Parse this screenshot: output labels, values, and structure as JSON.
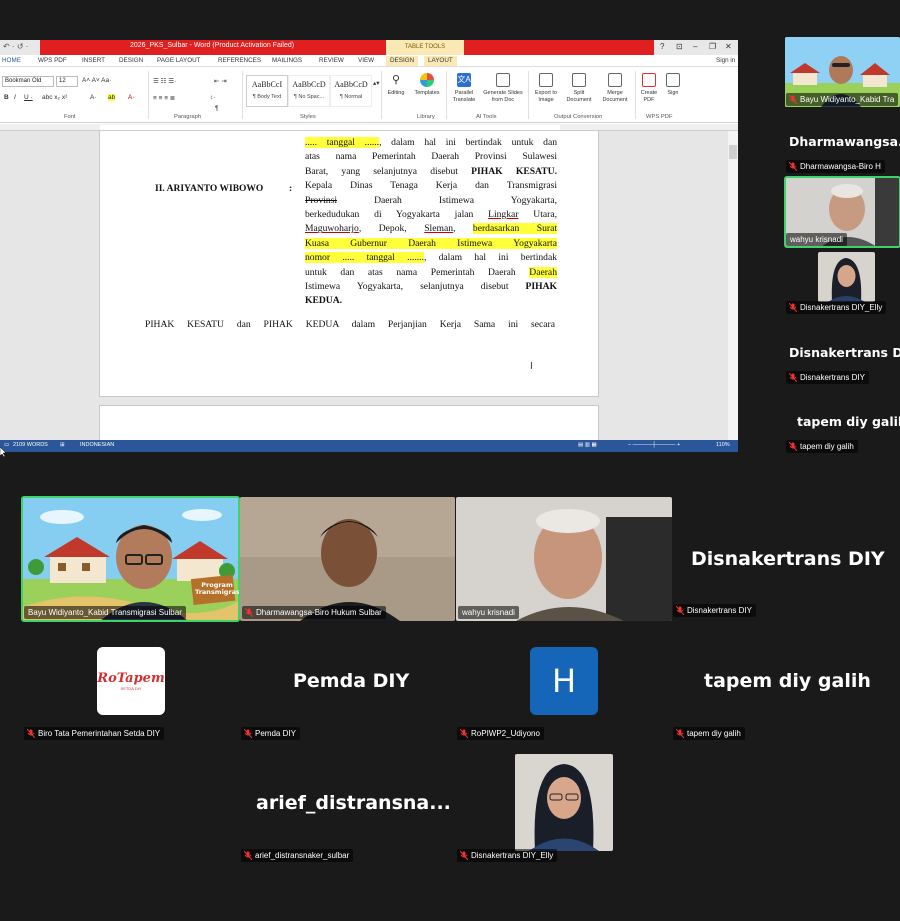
{
  "word": {
    "window_title": "2026_PKS_Sulbar - Word (Product Activation Failed)",
    "table_tools": "TABLE TOOLS",
    "sign_in": "Sign in",
    "tabs": [
      "HOME",
      "WPS PDF",
      "INSERT",
      "DESIGN",
      "PAGE LAYOUT",
      "REFERENCES",
      "MAILINGS",
      "REVIEW",
      "VIEW",
      "DESIGN",
      "LAYOUT"
    ],
    "font_name": "Bookman Old",
    "font_size": "12",
    "groups": {
      "font": "Font",
      "paragraph": "Paragraph",
      "styles": "Styles",
      "library": "Library",
      "ai_tools": "AI Tools",
      "output_conversion": "Output Conversion",
      "wps_pdf": "WPS PDF"
    },
    "styles": [
      {
        "preview": "AaBbCcI",
        "name": "¶ Body Text"
      },
      {
        "preview": "AaBbCcD",
        "name": "¶ No Spac..."
      },
      {
        "preview": "AaBbCcD",
        "name": "¶ Normal"
      }
    ],
    "tools": {
      "editing": "Editing",
      "templates": "Templates",
      "parallel_translate": "Parallel Translate",
      "generate_slides": "Generate Slides from Doc",
      "export_image": "Export to Image",
      "split_document": "Split Document",
      "merge_document": "Merge Document",
      "create_pdf": "Create PDF",
      "sign": "Sign"
    },
    "document": {
      "party_label": "II.  ARIYANTO WIBOWO",
      "colon": ":",
      "lines": [
        {
          "segments": [
            {
              "t": "..... tanggal ......",
              "hl": true
            },
            {
              "t": ", dalam hal ini bertindak untuk dan"
            }
          ]
        },
        {
          "segments": [
            {
              "t": "atas nama Pemerintah Daerah Provinsi Sulawesi"
            }
          ]
        },
        {
          "segments": [
            {
              "t": "Barat, yang selanjutnya disebut "
            },
            {
              "t": "PIHAK KESATU.",
              "b": true
            }
          ]
        },
        {
          "segments": [
            {
              "t": "Kepala Dinas Tenaga Kerja dan Transmigrasi"
            }
          ]
        },
        {
          "segments": [
            {
              "t": "Provinsi",
              "strike": true
            },
            {
              "t": " Daerah Istimewa Yogyakarta,"
            }
          ]
        },
        {
          "segments": [
            {
              "t": "berkedudukan di Yogyakarta jalan "
            },
            {
              "t": "Lingkar",
              "ul": true
            },
            {
              "t": " Utara,"
            }
          ]
        },
        {
          "segments": [
            {
              "t": "Maguwoharjo",
              "ul": true
            },
            {
              "t": ", Depok, "
            },
            {
              "t": "Sleman",
              "ul": true
            },
            {
              "t": ", "
            },
            {
              "t": "berdasarkan Surat",
              "hl": true
            }
          ]
        },
        {
          "segments": [
            {
              "t": "Kuasa Gubernur Daerah Istimewa Yogyakarta",
              "hl": true
            }
          ]
        },
        {
          "segments": [
            {
              "t": "nomor ..... tanggal .......",
              "hl": true
            },
            {
              "t": ", dalam hal ini bertindak"
            }
          ]
        },
        {
          "segments": [
            {
              "t": "untuk dan atas nama Pemerintah Daerah "
            },
            {
              "t": "Daerah",
              "hl": true
            }
          ]
        },
        {
          "segments": [
            {
              "t": "Istimewa Yogyakarta, selanjutnya disebut "
            },
            {
              "t": "PIHAK",
              "b": true
            }
          ]
        },
        {
          "segments": [
            {
              "t": "KEDUA.",
              "b": true
            }
          ],
          "last": true
        }
      ],
      "closing_line": "PIHAK KESATU dan PIHAK KEDUA dalam Perjanjian Kerja Sama ini secara"
    },
    "status": {
      "words": "2109 WORDS",
      "language": "INDONESIAN",
      "zoom": "110%"
    }
  },
  "participants": {
    "sidebar": {
      "bayu_label": "Bayu Widiyanto_Kabid Tra",
      "dharma_big": "Dharmawangsa...",
      "dharma_label": "Dharmawangsa-Biro H",
      "wahyu_label": "wahyu krisnadi",
      "elly_label": "Disnakertrans DIY_Elly",
      "disnaker_big": "Disnakertrans DIY",
      "disnaker_label": "Disnakertrans DIY",
      "tapem_big": "tapem diy galih",
      "tapem_label": "tapem diy galih"
    },
    "row1": [
      {
        "label": "Bayu Widiyanto_Kabid Transmigrasi Sulbar",
        "sign": "Program Transmigrasi"
      },
      {
        "label": "Dharmawangsa-Biro Hukum Sulbar"
      },
      {
        "label": "wahyu krisnadi"
      },
      {
        "big": "Disnakertrans DIY",
        "label": "Disnakertrans DIY"
      }
    ],
    "row2": [
      {
        "logo_text": "RoTapem",
        "logo_sub": "SETDA DIY",
        "label": "Biro Tata Pemerintahan Setda DIY"
      },
      {
        "big": "Pemda DIY",
        "label": "Pemda DIY"
      },
      {
        "initial": "H",
        "label": "RoPIWP2_Udiyono"
      },
      {
        "big": "tapem diy galih",
        "label": "tapem diy galih"
      }
    ],
    "row3": [
      {
        "big": "arief_distransna...",
        "label": "arief_distransnaker_sulbar"
      },
      {
        "label": "Disnakertrans DIY_Elly"
      }
    ]
  },
  "colors": {
    "speaking_outline": "#3ed26b",
    "word_status": "#2b579a",
    "highlight": "#ffff3a",
    "title_red": "#e02020",
    "h_avatar": "#1565b8"
  }
}
